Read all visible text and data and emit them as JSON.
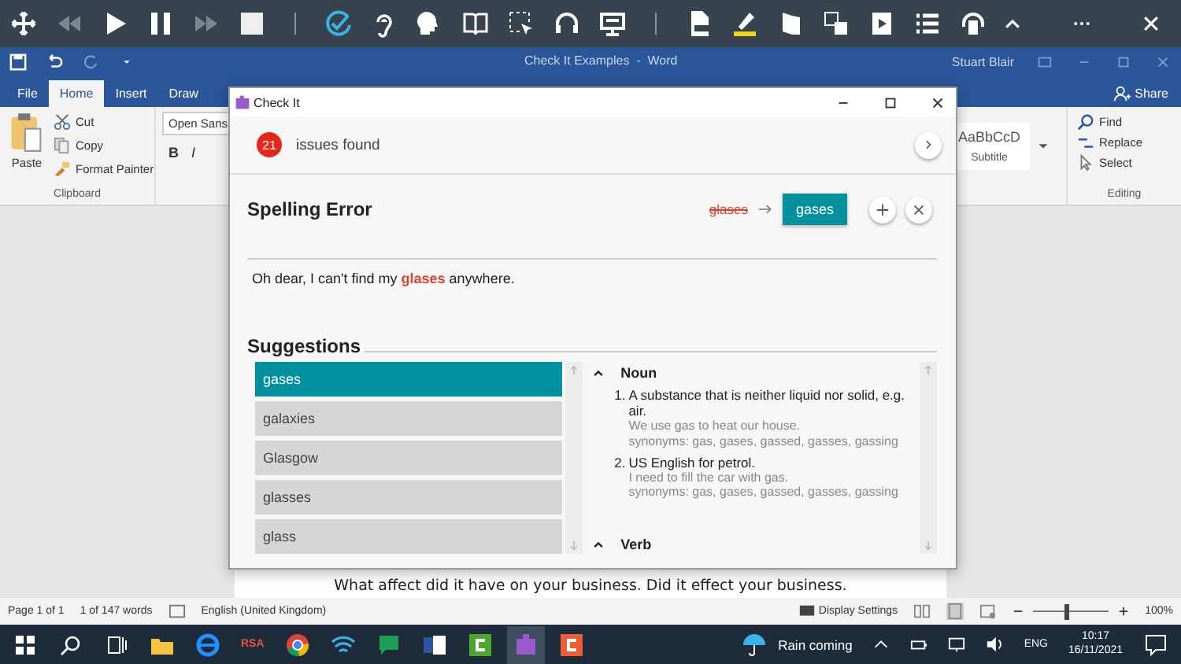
{
  "word": {
    "title": "Check It Examples  -  Word",
    "user": "Stuart Blair",
    "share": "Share",
    "tabs": [
      {
        "label": "File",
        "selected": false
      },
      {
        "label": "Home",
        "selected": true
      },
      {
        "label": "Insert",
        "selected": false
      },
      {
        "label": "Draw",
        "selected": false
      }
    ],
    "clipboard": {
      "paste": "Paste",
      "items": [
        "Cut",
        "Copy",
        "Format Painter"
      ],
      "group": "Clipboard"
    },
    "font": {
      "name": "Open Sans",
      "buttons": [
        "B",
        "I"
      ]
    },
    "styles": {
      "preview": "AaBbCcD",
      "name": "Subtitle"
    },
    "editing": {
      "items": [
        "Find",
        "Replace",
        "Select"
      ],
      "group": "Editing"
    },
    "document_line": "What affect did it have on your business. Did it effect your business.",
    "status_bar": {
      "page": "Page 1 of 1",
      "words": "1 of 147 words",
      "language": "English (United Kingdom)",
      "display": "Display Settings",
      "zoom": {
        "level": 0.45
      },
      "zoom_value": "100%"
    }
  },
  "dialog": {
    "title": "Check It",
    "issue_count": "21",
    "issues_label": "issues found",
    "error_type": "Spelling Error",
    "wrong_word": "glases",
    "replacement": "gases",
    "sentence": {
      "before": "Oh dear, I can't find my ",
      "error": "glases",
      "after": " anywhere."
    },
    "suggestions_heading": "Suggestions",
    "suggestions": [
      {
        "label": "gases",
        "selected": true
      },
      {
        "label": "galaxies",
        "selected": false
      },
      {
        "label": "Glasgow",
        "selected": false
      },
      {
        "label": "glasses",
        "selected": false
      },
      {
        "label": "glass",
        "selected": false
      }
    ],
    "definitions": [
      {
        "part_of_speech": "Noun",
        "senses": [
          {
            "number": "1.",
            "text": "A substance that is neither liquid nor solid, e.g. air.",
            "example": "We use gas to heat our house.",
            "synonyms": "synonyms: gas, gases, gassed, gasses, gassing"
          },
          {
            "number": "2.",
            "text": "US English for petrol.",
            "example": "I need to fill the car with gas.",
            "synonyms": "synonyms: gas, gases, gassed, gasses, gassing"
          }
        ]
      },
      {
        "part_of_speech": "Verb"
      }
    ]
  },
  "taskbar": {
    "app_label": "RSA",
    "weather": "Rain coming",
    "language": "ENG",
    "time": "10:17",
    "date": "16/11/2021"
  }
}
